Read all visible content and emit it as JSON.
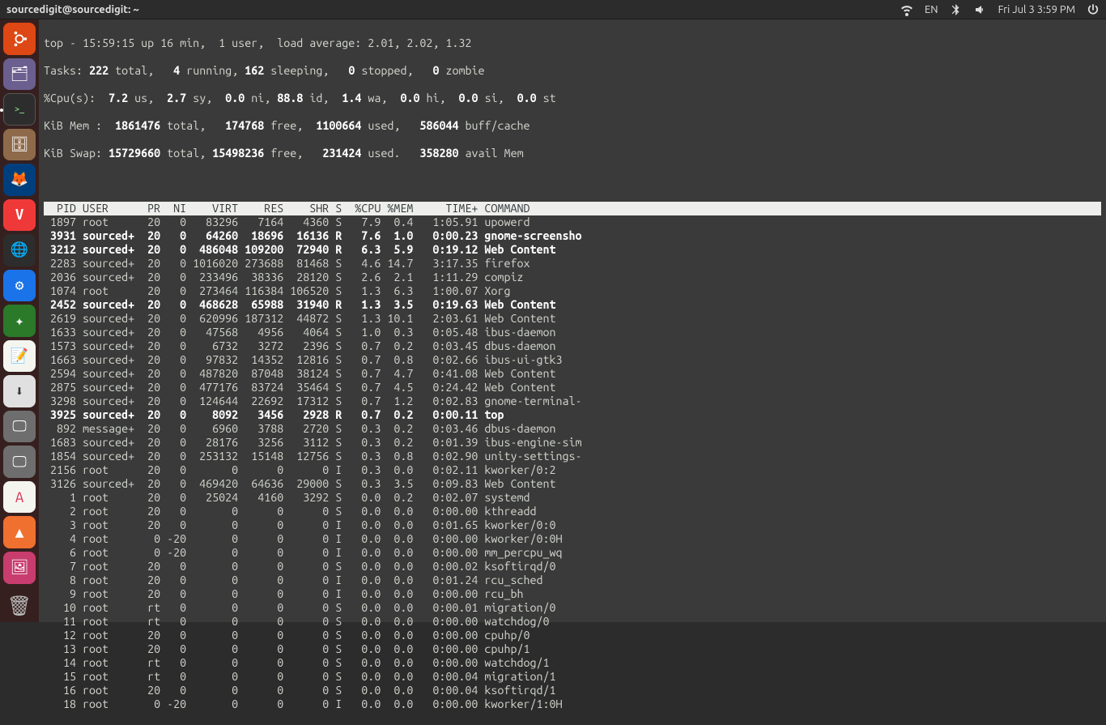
{
  "menubar": {
    "title": "sourcedigit@sourcedigit: ~",
    "lang": "EN",
    "clock": "Fri Jul 3  3:59 PM"
  },
  "launcher": {
    "items": [
      {
        "name": "ubuntu-dash",
        "glyph": "◯"
      },
      {
        "name": "files",
        "glyph": "📁"
      },
      {
        "name": "terminal",
        "glyph": ">_"
      },
      {
        "name": "nautilus",
        "glyph": "🗄"
      },
      {
        "name": "firefox",
        "glyph": "🦊"
      },
      {
        "name": "vivaldi",
        "glyph": "V"
      },
      {
        "name": "chrome",
        "glyph": "◎"
      },
      {
        "name": "settings",
        "glyph": "⚙"
      },
      {
        "name": "tweaks",
        "glyph": "✦"
      },
      {
        "name": "notes",
        "glyph": "📝"
      },
      {
        "name": "downloads",
        "glyph": "⬇"
      },
      {
        "name": "display1",
        "glyph": "🖵"
      },
      {
        "name": "display2",
        "glyph": "🖵"
      },
      {
        "name": "software",
        "glyph": "A"
      },
      {
        "name": "vlc",
        "glyph": "▲"
      },
      {
        "name": "images",
        "glyph": "🖼"
      },
      {
        "name": "trash",
        "glyph": "🗑"
      }
    ]
  },
  "top": {
    "line1": "top - 15:59:15 up 16 min,  1 user,  load average: 2.01, 2.02, 1.32",
    "tasks_label": "Tasks:",
    "tasks_total": "222",
    "tasks_total_sfx": " total,",
    "tasks_running": "4",
    "tasks_running_sfx": " running,",
    "tasks_sleeping": "162",
    "tasks_sleeping_sfx": " sleeping,",
    "tasks_stopped": "0",
    "tasks_stopped_sfx": " stopped,",
    "tasks_zombie": "0",
    "tasks_zombie_sfx": " zombie",
    "cpu_label": "%Cpu(s):",
    "cpu_us": "7.2",
    "cpu_us_sfx": " us,",
    "cpu_sy": "2.7",
    "cpu_sy_sfx": " sy,",
    "cpu_ni": "0.0",
    "cpu_ni_sfx": " ni,",
    "cpu_id": "88.8",
    "cpu_id_sfx": " id,",
    "cpu_wa": "1.4",
    "cpu_wa_sfx": " wa,",
    "cpu_hi": "0.0",
    "cpu_hi_sfx": " hi,",
    "cpu_si": "0.0",
    "cpu_si_sfx": " si,",
    "cpu_st": "0.0",
    "cpu_st_sfx": " st",
    "mem_label": "KiB Mem :",
    "mem_total": "1861476",
    "mem_total_sfx": " total,",
    "mem_free": "174768",
    "mem_free_sfx": " free,",
    "mem_used": "1100664",
    "mem_used_sfx": " used,",
    "mem_buff": "586044",
    "mem_buff_sfx": " buff/cache",
    "swap_label": "KiB Swap:",
    "swap_total": "15729660",
    "swap_total_sfx": " total,",
    "swap_free": "15498236",
    "swap_free_sfx": " free,",
    "swap_used": "231424",
    "swap_used_sfx": " used.",
    "swap_avail": "358280",
    "swap_avail_sfx": " avail Mem",
    "columns": "  PID USER      PR  NI    VIRT    RES    SHR S  %CPU %MEM     TIME+ COMMAND                                                              ",
    "rows": [
      {
        "b": false,
        "pid": "1897",
        "user": "root    ",
        "pr": "20",
        "ni": "  0",
        "virt": "  83296",
        "res": "  7164",
        "shr": "  4360",
        "s": "S",
        "cpu": " 7.9",
        "mem": " 0.4",
        "time": "  1:05.91",
        "cmd": "upowerd"
      },
      {
        "b": true,
        "pid": "3931",
        "user": "sourced+",
        "pr": "20",
        "ni": "  0",
        "virt": "  64260",
        "res": " 18696",
        "shr": " 16136",
        "s": "R",
        "cpu": " 7.6",
        "mem": " 1.0",
        "time": "  0:00.23",
        "cmd": "gnome-screensho"
      },
      {
        "b": true,
        "pid": "3212",
        "user": "sourced+",
        "pr": "20",
        "ni": "  0",
        "virt": " 486048",
        "res": "109200",
        "shr": " 72940",
        "s": "R",
        "cpu": " 6.3",
        "mem": " 5.9",
        "time": "  0:19.12",
        "cmd": "Web Content"
      },
      {
        "b": false,
        "pid": "2283",
        "user": "sourced+",
        "pr": "20",
        "ni": "  0",
        "virt": "1016020",
        "res": "273688",
        "shr": " 81468",
        "s": "S",
        "cpu": " 4.6",
        "mem": "14.7",
        "time": "  3:17.35",
        "cmd": "firefox"
      },
      {
        "b": false,
        "pid": "2036",
        "user": "sourced+",
        "pr": "20",
        "ni": "  0",
        "virt": " 233496",
        "res": " 38336",
        "shr": " 28120",
        "s": "S",
        "cpu": " 2.6",
        "mem": " 2.1",
        "time": "  1:11.29",
        "cmd": "compiz"
      },
      {
        "b": false,
        "pid": "1074",
        "user": "root    ",
        "pr": "20",
        "ni": "  0",
        "virt": " 273464",
        "res": "116384",
        "shr": "106520",
        "s": "S",
        "cpu": " 1.3",
        "mem": " 6.3",
        "time": "  1:00.07",
        "cmd": "Xorg"
      },
      {
        "b": true,
        "pid": "2452",
        "user": "sourced+",
        "pr": "20",
        "ni": "  0",
        "virt": " 468628",
        "res": " 65988",
        "shr": " 31940",
        "s": "R",
        "cpu": " 1.3",
        "mem": " 3.5",
        "time": "  0:19.63",
        "cmd": "Web Content"
      },
      {
        "b": false,
        "pid": "2619",
        "user": "sourced+",
        "pr": "20",
        "ni": "  0",
        "virt": " 620996",
        "res": "187312",
        "shr": " 44872",
        "s": "S",
        "cpu": " 1.3",
        "mem": "10.1",
        "time": "  2:03.61",
        "cmd": "Web Content"
      },
      {
        "b": false,
        "pid": "1633",
        "user": "sourced+",
        "pr": "20",
        "ni": "  0",
        "virt": "  47568",
        "res": "  4956",
        "shr": "  4064",
        "s": "S",
        "cpu": " 1.0",
        "mem": " 0.3",
        "time": "  0:05.48",
        "cmd": "ibus-daemon"
      },
      {
        "b": false,
        "pid": "1573",
        "user": "sourced+",
        "pr": "20",
        "ni": "  0",
        "virt": "   6732",
        "res": "  3272",
        "shr": "  2396",
        "s": "S",
        "cpu": " 0.7",
        "mem": " 0.2",
        "time": "  0:03.45",
        "cmd": "dbus-daemon"
      },
      {
        "b": false,
        "pid": "1663",
        "user": "sourced+",
        "pr": "20",
        "ni": "  0",
        "virt": "  97832",
        "res": " 14352",
        "shr": " 12816",
        "s": "S",
        "cpu": " 0.7",
        "mem": " 0.8",
        "time": "  0:02.66",
        "cmd": "ibus-ui-gtk3"
      },
      {
        "b": false,
        "pid": "2594",
        "user": "sourced+",
        "pr": "20",
        "ni": "  0",
        "virt": " 487820",
        "res": " 87048",
        "shr": " 38124",
        "s": "S",
        "cpu": " 0.7",
        "mem": " 4.7",
        "time": "  0:41.08",
        "cmd": "Web Content"
      },
      {
        "b": false,
        "pid": "2875",
        "user": "sourced+",
        "pr": "20",
        "ni": "  0",
        "virt": " 477176",
        "res": " 83724",
        "shr": " 35464",
        "s": "S",
        "cpu": " 0.7",
        "mem": " 4.5",
        "time": "  0:24.42",
        "cmd": "Web Content"
      },
      {
        "b": false,
        "pid": "3298",
        "user": "sourced+",
        "pr": "20",
        "ni": "  0",
        "virt": " 124644",
        "res": " 22692",
        "shr": " 17312",
        "s": "S",
        "cpu": " 0.7",
        "mem": " 1.2",
        "time": "  0:02.83",
        "cmd": "gnome-terminal-"
      },
      {
        "b": true,
        "pid": "3925",
        "user": "sourced+",
        "pr": "20",
        "ni": "  0",
        "virt": "   8092",
        "res": "  3456",
        "shr": "  2928",
        "s": "R",
        "cpu": " 0.7",
        "mem": " 0.2",
        "time": "  0:00.11",
        "cmd": "top"
      },
      {
        "b": false,
        "pid": " 892",
        "user": "message+",
        "pr": "20",
        "ni": "  0",
        "virt": "   6960",
        "res": "  3788",
        "shr": "  2720",
        "s": "S",
        "cpu": " 0.3",
        "mem": " 0.2",
        "time": "  0:03.46",
        "cmd": "dbus-daemon"
      },
      {
        "b": false,
        "pid": "1683",
        "user": "sourced+",
        "pr": "20",
        "ni": "  0",
        "virt": "  28176",
        "res": "  3256",
        "shr": "  3112",
        "s": "S",
        "cpu": " 0.3",
        "mem": " 0.2",
        "time": "  0:01.39",
        "cmd": "ibus-engine-sim"
      },
      {
        "b": false,
        "pid": "1854",
        "user": "sourced+",
        "pr": "20",
        "ni": "  0",
        "virt": " 253132",
        "res": " 15148",
        "shr": " 12756",
        "s": "S",
        "cpu": " 0.3",
        "mem": " 0.8",
        "time": "  0:02.90",
        "cmd": "unity-settings-"
      },
      {
        "b": false,
        "pid": "2156",
        "user": "root    ",
        "pr": "20",
        "ni": "  0",
        "virt": "      0",
        "res": "     0",
        "shr": "     0",
        "s": "I",
        "cpu": " 0.3",
        "mem": " 0.0",
        "time": "  0:02.11",
        "cmd": "kworker/0:2"
      },
      {
        "b": false,
        "pid": "3126",
        "user": "sourced+",
        "pr": "20",
        "ni": "  0",
        "virt": " 469420",
        "res": " 64636",
        "shr": " 29000",
        "s": "S",
        "cpu": " 0.3",
        "mem": " 3.5",
        "time": "  0:09.83",
        "cmd": "Web Content"
      },
      {
        "b": false,
        "pid": "   1",
        "user": "root    ",
        "pr": "20",
        "ni": "  0",
        "virt": "  25024",
        "res": "  4160",
        "shr": "  3292",
        "s": "S",
        "cpu": " 0.0",
        "mem": " 0.2",
        "time": "  0:02.07",
        "cmd": "systemd"
      },
      {
        "b": false,
        "pid": "   2",
        "user": "root    ",
        "pr": "20",
        "ni": "  0",
        "virt": "      0",
        "res": "     0",
        "shr": "     0",
        "s": "S",
        "cpu": " 0.0",
        "mem": " 0.0",
        "time": "  0:00.00",
        "cmd": "kthreadd"
      },
      {
        "b": false,
        "pid": "   3",
        "user": "root    ",
        "pr": "20",
        "ni": "  0",
        "virt": "      0",
        "res": "     0",
        "shr": "     0",
        "s": "I",
        "cpu": " 0.0",
        "mem": " 0.0",
        "time": "  0:01.65",
        "cmd": "kworker/0:0"
      },
      {
        "b": false,
        "pid": "   4",
        "user": "root    ",
        "pr": " 0",
        "ni": "-20",
        "virt": "      0",
        "res": "     0",
        "shr": "     0",
        "s": "I",
        "cpu": " 0.0",
        "mem": " 0.0",
        "time": "  0:00.00",
        "cmd": "kworker/0:0H"
      },
      {
        "b": false,
        "pid": "   6",
        "user": "root    ",
        "pr": " 0",
        "ni": "-20",
        "virt": "      0",
        "res": "     0",
        "shr": "     0",
        "s": "I",
        "cpu": " 0.0",
        "mem": " 0.0",
        "time": "  0:00.00",
        "cmd": "mm_percpu_wq"
      },
      {
        "b": false,
        "pid": "   7",
        "user": "root    ",
        "pr": "20",
        "ni": "  0",
        "virt": "      0",
        "res": "     0",
        "shr": "     0",
        "s": "S",
        "cpu": " 0.0",
        "mem": " 0.0",
        "time": "  0:00.02",
        "cmd": "ksoftirqd/0"
      },
      {
        "b": false,
        "pid": "   8",
        "user": "root    ",
        "pr": "20",
        "ni": "  0",
        "virt": "      0",
        "res": "     0",
        "shr": "     0",
        "s": "I",
        "cpu": " 0.0",
        "mem": " 0.0",
        "time": "  0:01.24",
        "cmd": "rcu_sched"
      },
      {
        "b": false,
        "pid": "   9",
        "user": "root    ",
        "pr": "20",
        "ni": "  0",
        "virt": "      0",
        "res": "     0",
        "shr": "     0",
        "s": "I",
        "cpu": " 0.0",
        "mem": " 0.0",
        "time": "  0:00.00",
        "cmd": "rcu_bh"
      },
      {
        "b": false,
        "pid": "  10",
        "user": "root    ",
        "pr": "rt",
        "ni": "  0",
        "virt": "      0",
        "res": "     0",
        "shr": "     0",
        "s": "S",
        "cpu": " 0.0",
        "mem": " 0.0",
        "time": "  0:00.01",
        "cmd": "migration/0"
      },
      {
        "b": false,
        "pid": "  11",
        "user": "root    ",
        "pr": "rt",
        "ni": "  0",
        "virt": "      0",
        "res": "     0",
        "shr": "     0",
        "s": "S",
        "cpu": " 0.0",
        "mem": " 0.0",
        "time": "  0:00.00",
        "cmd": "watchdog/0"
      },
      {
        "b": false,
        "pid": "  12",
        "user": "root    ",
        "pr": "20",
        "ni": "  0",
        "virt": "      0",
        "res": "     0",
        "shr": "     0",
        "s": "S",
        "cpu": " 0.0",
        "mem": " 0.0",
        "time": "  0:00.00",
        "cmd": "cpuhp/0"
      },
      {
        "b": false,
        "pid": "  13",
        "user": "root    ",
        "pr": "20",
        "ni": "  0",
        "virt": "      0",
        "res": "     0",
        "shr": "     0",
        "s": "S",
        "cpu": " 0.0",
        "mem": " 0.0",
        "time": "  0:00.00",
        "cmd": "cpuhp/1"
      },
      {
        "b": false,
        "pid": "  14",
        "user": "root    ",
        "pr": "rt",
        "ni": "  0",
        "virt": "      0",
        "res": "     0",
        "shr": "     0",
        "s": "S",
        "cpu": " 0.0",
        "mem": " 0.0",
        "time": "  0:00.00",
        "cmd": "watchdog/1"
      },
      {
        "b": false,
        "pid": "  15",
        "user": "root    ",
        "pr": "rt",
        "ni": "  0",
        "virt": "      0",
        "res": "     0",
        "shr": "     0",
        "s": "S",
        "cpu": " 0.0",
        "mem": " 0.0",
        "time": "  0:00.04",
        "cmd": "migration/1"
      },
      {
        "b": false,
        "pid": "  16",
        "user": "root    ",
        "pr": "20",
        "ni": "  0",
        "virt": "      0",
        "res": "     0",
        "shr": "     0",
        "s": "S",
        "cpu": " 0.0",
        "mem": " 0.0",
        "time": "  0:00.04",
        "cmd": "ksoftirqd/1"
      },
      {
        "b": false,
        "pid": "  18",
        "user": "root    ",
        "pr": " 0",
        "ni": "-20",
        "virt": "      0",
        "res": "     0",
        "shr": "     0",
        "s": "I",
        "cpu": " 0.0",
        "mem": " 0.0",
        "time": "  0:00.00",
        "cmd": "kworker/1:0H"
      }
    ]
  }
}
